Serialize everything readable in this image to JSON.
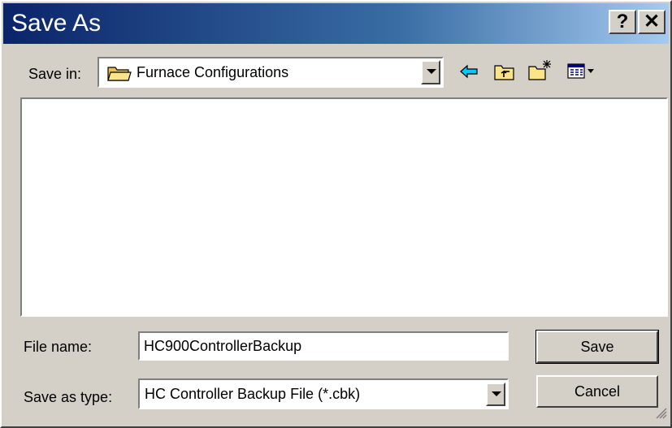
{
  "window": {
    "title": "Save As"
  },
  "titlebar": {
    "help_label": "?",
    "close_label": "✕"
  },
  "save_in": {
    "label": "Save in:",
    "value": "Furnace Configurations",
    "icon": "folder-icon"
  },
  "toolbar": {
    "back_icon": "back-arrow-icon",
    "up_icon": "up-folder-icon",
    "new_folder_icon": "new-folder-icon",
    "view_icon": "view-menu-icon"
  },
  "file_name": {
    "label": "File name:",
    "value": "HC900ControllerBackup"
  },
  "save_as_type": {
    "label": "Save as type:",
    "value": "HC Controller Backup File (*.cbk)"
  },
  "buttons": {
    "save": "Save",
    "cancel": "Cancel"
  },
  "colors": {
    "title_start": "#0a246a",
    "title_end": "#a6caf0",
    "face": "#d4d0c8"
  }
}
